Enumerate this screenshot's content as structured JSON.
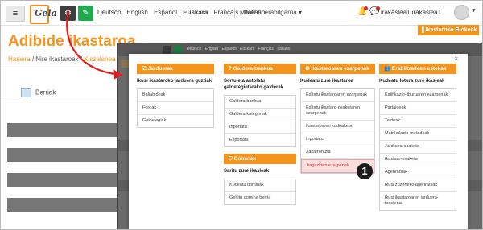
{
  "navbar": {
    "logo_text": "Gela",
    "languages": [
      {
        "label": "Deutsch",
        "active": false
      },
      {
        "label": "English",
        "active": false
      },
      {
        "label": "Español",
        "active": false
      },
      {
        "label": "Euskara",
        "active": true
      },
      {
        "label": "Français",
        "active": false
      },
      {
        "label": "Italiano",
        "active": false
      }
    ],
    "material_menu": "Material erabilgarria",
    "user_name": "irakaslea1 irakaslea1"
  },
  "page": {
    "blocks_button": "Ikastaroko Blokeak",
    "title": "Adibide ikastaroa",
    "breadcrumb": {
      "home": "Hasiera",
      "sep": "/",
      "my_courses": "Nire ikastaroak",
      "course": "Kiszelanea"
    },
    "forum_label": "Berriak"
  },
  "overlay": {
    "languages": [
      "Deutsch",
      "English",
      "Español",
      "Euskara",
      "Français",
      "Italiano"
    ]
  },
  "modal": {
    "close_label": "×",
    "columns": [
      {
        "header": "Jarduerak",
        "subtitle": "Ikusi ikastaroko jarduera guztiak",
        "items": [
          "Baliabideak",
          "Foroak",
          "Galdetegiak"
        ]
      },
      {
        "header": "Galdera-bankua",
        "subtitle": "Sortu eta antolatu galdetegietarako galderak",
        "items": [
          "Galdera-bankua",
          "Galdera-kategoriak",
          "Inportatu",
          "Esportatu"
        ],
        "sub_section": {
          "header": "Dominak",
          "subtitle": "Saritu zure ikasleak",
          "items": [
            "Kudeatu dominak",
            "Gehitu domina berria"
          ]
        }
      },
      {
        "header": "Ikastaroaren ezarpenak",
        "subtitle": "Kudeatu zure ikastaroa",
        "items": [
          "Editatu ikastaroaren ezarpenak",
          "Editatu ikastaro-osaketaren ezarpenak",
          "Ikastaroaren kudeaketa",
          "Inportatu",
          "Zakarrontzia",
          "Iragazkien ezarpenak"
        ],
        "highlighted_index": 5
      },
      {
        "header": "Erabiltzaileen estekak",
        "subtitle": "Kudeatu lotura zure ikasleak",
        "items": [
          "Kalifikazio-liburuaren ezarpenak",
          "Partaideak",
          "Taldeak",
          "Matrikulazio-metodoak",
          "Jarduera-osaketa",
          "Ikastaro-osaketa",
          "Ageriradiak",
          "Ikusi zuzeneko ageriradiak",
          "Ikusi ikastaroaren jarduera-txostena"
        ]
      }
    ]
  },
  "callout": {
    "number": "1"
  },
  "colors": {
    "accent": "#f3941e",
    "arrow": "#e02020",
    "highlight_bg": "#f9dede"
  }
}
